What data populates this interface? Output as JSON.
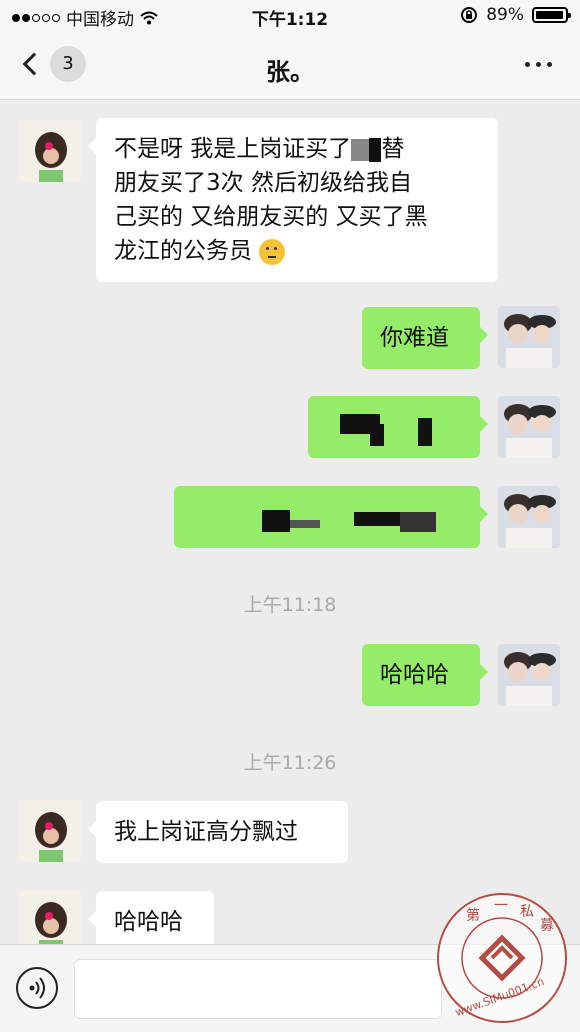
{
  "status_bar": {
    "carrier": "中国移动",
    "time": "下午1:12",
    "battery": "89%"
  },
  "nav": {
    "unread_count": "3",
    "title": "张。"
  },
  "messages": [
    {
      "sender": "them",
      "text_lines": [
        "不是呀 我是上岗证买了",
        "朋友买了3次 然后初级给我自",
        "己买的 又给朋友买的 又买了黑",
        "龙江的公务员"
      ],
      "redacted_after_line1": "替"
    },
    {
      "sender": "me",
      "text": "你难道"
    },
    {
      "sender": "me",
      "redacted": true
    },
    {
      "sender": "me",
      "redacted": true
    },
    {
      "sender": "me",
      "text": "哈哈哈"
    },
    {
      "sender": "them",
      "text": "我上岗证高分飘过"
    },
    {
      "sender": "them",
      "text": "哈哈哈"
    }
  ],
  "timestamps": [
    "上午11:18",
    "上午11:26"
  ],
  "watermark": {
    "text": "第一私募",
    "url_text": "www.simu001.cn"
  },
  "colors": {
    "my_bubble": "#95ec69",
    "their_bubble": "#ffffff",
    "background": "#ececec"
  }
}
